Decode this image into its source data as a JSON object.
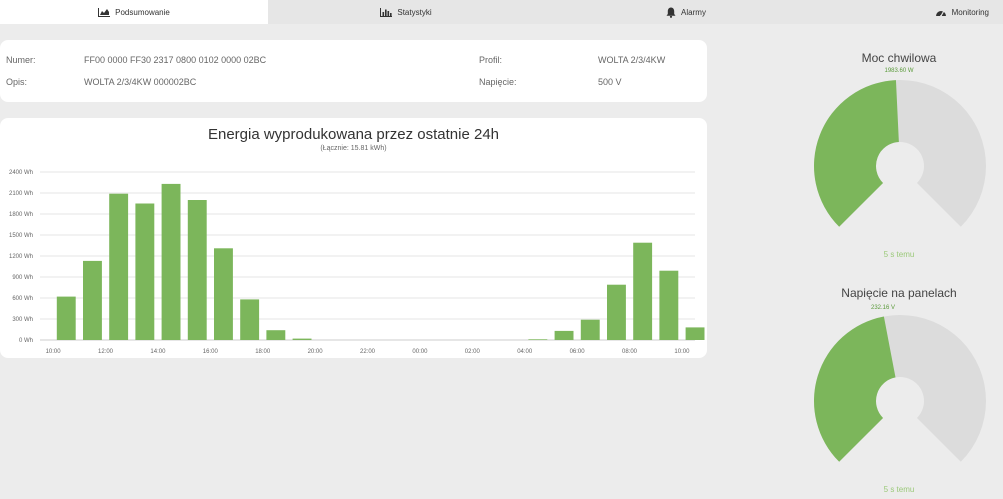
{
  "nav": {
    "tabs": [
      {
        "label": "Podsumowanie",
        "icon": "area-chart-icon",
        "active": true
      },
      {
        "label": "Statystyki",
        "icon": "bar-chart-icon",
        "active": false
      },
      {
        "label": "Alarmy",
        "icon": "bell-icon",
        "active": false
      },
      {
        "label": "Monitoring",
        "icon": "dashboard-icon",
        "active": false
      }
    ]
  },
  "info": {
    "numer_label": "Numer:",
    "numer_value": "FF00 0000 FF30 2317 0800 0102 0000 02BC",
    "opis_label": "Opis:",
    "opis_value": "WOLTA 2/3/4KW 000002BC",
    "profil_label": "Profil:",
    "profil_value": "WOLTA 2/3/4KW",
    "napiecie_label": "Napięcie:",
    "napiecie_value": "500 V"
  },
  "chart": {
    "title": "Energia wyprodukowana przez ostatnie 24h",
    "subtitle": "(Łącznie: 15.81 kWh)"
  },
  "chart_data": {
    "type": "bar",
    "title": "Energia wyprodukowana przez ostatnie 24h",
    "subtitle": "(Łącznie: 15.81 kWh)",
    "y_ticks": [
      "0 Wh",
      "300 Wh",
      "600 Wh",
      "900 Wh",
      "1200 Wh",
      "1500 Wh",
      "1800 Wh",
      "2100 Wh",
      "2400 Wh"
    ],
    "x_ticks": [
      "10:00",
      "12:00",
      "14:00",
      "16:00",
      "18:00",
      "20:00",
      "22:00",
      "00:00",
      "02:00",
      "04:00",
      "06:00",
      "08:00",
      "10:00"
    ],
    "ylim": [
      0,
      2400
    ],
    "series_color": "#7cb65b",
    "values": [
      620,
      1130,
      2090,
      1950,
      2230,
      2000,
      1310,
      580,
      140,
      20,
      0,
      0,
      0,
      0,
      0,
      0,
      0,
      0,
      10,
      130,
      290,
      790,
      1390,
      990,
      180
    ],
    "grid": true
  },
  "gauges": [
    {
      "title": "Moc chwilowa",
      "value": "1983.60 W",
      "fraction": 0.49,
      "ago": "5 s temu"
    },
    {
      "title": "Napięcie na panelach",
      "value": "232.16 V",
      "fraction": 0.46,
      "ago": "5 s temu"
    }
  ],
  "colors": {
    "accent": "#7cb65b",
    "gauge_bg": "#dcdcdc"
  }
}
